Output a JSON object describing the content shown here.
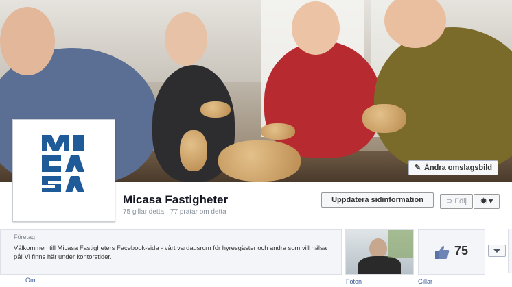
{
  "cover": {
    "change_cover_label": "Ändra omslagsbild"
  },
  "page": {
    "name": "Micasa Fastigheter",
    "stats": "75 gillar detta · 77 pratar om detta",
    "logo_text": "MICASA"
  },
  "actions": {
    "update_info_label": "Uppdatera sidinformation",
    "follow_label": "Följ"
  },
  "about": {
    "category": "Företag",
    "description": "Välkommen till Micasa Fastigheters Facebook-sida - vårt vardagsrum för hyresgäster och andra som vill hälsa på! Vi finns här under kontorstider.",
    "link_label": "Om"
  },
  "tiles": {
    "photos_label": "Foton",
    "likes_label": "Gillar",
    "likes_count": "75"
  },
  "colors": {
    "brand_blue": "#1f5b99",
    "link_blue": "#3b5998"
  }
}
